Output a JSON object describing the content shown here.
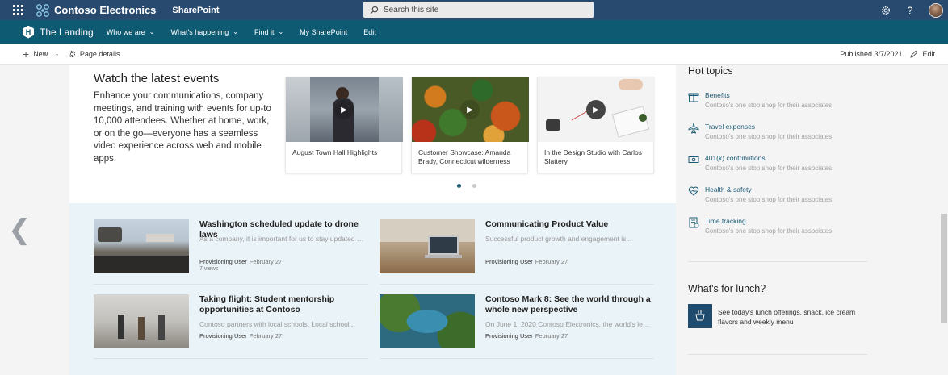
{
  "suitebar": {
    "brand": "Contoso Electronics",
    "app": "SharePoint",
    "search_placeholder": "Search this site",
    "icons": [
      "waffle-icon",
      "settings-icon",
      "help-icon",
      "avatar"
    ]
  },
  "sitenav": {
    "title": "The Landing",
    "logo_letter": "H",
    "items": [
      {
        "label": "Who we are",
        "dropdown": true
      },
      {
        "label": "What's happening",
        "dropdown": true
      },
      {
        "label": "Find it",
        "dropdown": true
      },
      {
        "label": "My SharePoint",
        "dropdown": false
      },
      {
        "label": "Edit",
        "dropdown": false
      }
    ]
  },
  "cmdbar": {
    "new_label": "New",
    "page_details_label": "Page details",
    "published": "Published 3/7/2021",
    "edit_label": "Edit"
  },
  "events": {
    "title": "Watch the latest events",
    "description": "Enhance your communications, company meetings, and training with events for up-to 10,000 attendees. Whether at home, work, or on the go—everyone has a seamless video experience across web and mobile apps.",
    "videos": [
      {
        "title": "August Town Hall Highlights"
      },
      {
        "title": "Customer Showcase: Amanda Brady, Connecticut wilderness"
      },
      {
        "title": "In the Design Studio with Carlos Slattery"
      }
    ],
    "carousel_pages": 2,
    "carousel_active": 1
  },
  "news": [
    {
      "title": "Washington scheduled update to drone laws",
      "desc": "As a company, it is important for us to stay updated o...",
      "author": "Provisioning User",
      "date": "February 27",
      "views": "7 views"
    },
    {
      "title": "Communicating Product Value",
      "desc": "Successful product growth and engagement is...",
      "author": "Provisioning User",
      "date": "February 27",
      "views": ""
    },
    {
      "title": "Taking flight: Student mentorship opportunities at Contoso",
      "desc": "Contoso partners with local schools. Local school...",
      "author": "Provisioning User",
      "date": "February 27",
      "views": ""
    },
    {
      "title": "Contoso Mark 8: See the world through a whole new perspective",
      "desc": "On June 1, 2020 Contoso Electronics, the world's lead...",
      "author": "Provisioning User",
      "date": "February 27",
      "views": ""
    }
  ],
  "hot_topics": {
    "title": "Hot topics",
    "items": [
      {
        "label": "Benefits",
        "desc": "Contoso's one stop shop for their associates",
        "icon": "gift-icon"
      },
      {
        "label": "Travel expenses",
        "desc": "Contoso's one stop shop for their associates",
        "icon": "airplane-icon"
      },
      {
        "label": "401(k) contributions",
        "desc": "Contoso's one stop shop for their associates",
        "icon": "money-icon"
      },
      {
        "label": "Health & safety",
        "desc": "Contoso's one stop shop for their associates",
        "icon": "heart-icon"
      },
      {
        "label": "Time tracking",
        "desc": "Contoso's one stop shop for their associates",
        "icon": "timesheet-icon"
      }
    ]
  },
  "lunch": {
    "title": "What's for lunch?",
    "text": "See today's lunch offerings, snack, ice cream flavors and weekly menu",
    "icon": "food-icon"
  },
  "colors": {
    "suitebar": "#274a6e",
    "sitenav": "#0f5a73",
    "accent": "#1c5b74"
  }
}
